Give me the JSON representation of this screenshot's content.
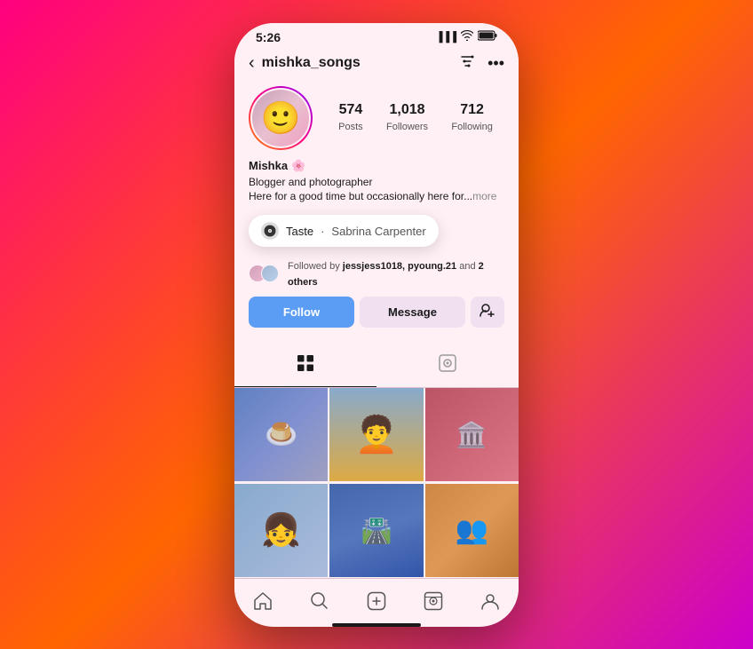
{
  "phone": {
    "status": {
      "time": "5:26",
      "signal": "▪▪▪",
      "wifi": "wifi",
      "battery": "battery"
    },
    "nav": {
      "back_label": "‹",
      "username": "mishka_songs",
      "filter_icon": "filter",
      "more_icon": "more"
    },
    "profile": {
      "name": "Mishka",
      "emoji": "🌸",
      "bio_line1": "Blogger and photographer",
      "bio_line2": "Here for a good time but occasionally here for...",
      "more_label": "more",
      "stats": {
        "posts": {
          "count": "574",
          "label": "Posts"
        },
        "followers": {
          "count": "1,018",
          "label": "Followers"
        },
        "following": {
          "count": "712",
          "label": "Following"
        }
      }
    },
    "tooltip": {
      "icon": "♪",
      "label": "Taste",
      "separator": "·",
      "artist": "Sabrina Carpenter"
    },
    "followed_by": {
      "text": "Followed by ",
      "users": "jessjess1018, pyoung.21",
      "and_label": " and ",
      "others": "2 others"
    },
    "buttons": {
      "follow": "Follow",
      "message": "Message",
      "add_icon": "👤+"
    },
    "tabs": {
      "grid_icon": "⊞",
      "tagged_icon": "◉"
    },
    "grid": {
      "cells": [
        {
          "id": 1,
          "class": "cell-1",
          "content": "food"
        },
        {
          "id": 2,
          "class": "cell-2",
          "content": "person"
        },
        {
          "id": 3,
          "class": "cell-3",
          "content": "temple"
        },
        {
          "id": 4,
          "class": "cell-4",
          "content": "girl"
        },
        {
          "id": 5,
          "class": "cell-5",
          "content": "road"
        },
        {
          "id": 6,
          "class": "cell-6",
          "content": "group"
        }
      ]
    },
    "bottom_nav": {
      "items": [
        {
          "id": "home",
          "icon": "⌂",
          "label": "Home"
        },
        {
          "id": "search",
          "icon": "🔍",
          "label": "Search"
        },
        {
          "id": "add",
          "icon": "⊕",
          "label": "Add"
        },
        {
          "id": "reels",
          "icon": "▶",
          "label": "Reels"
        },
        {
          "id": "profile",
          "icon": "○",
          "label": "Profile"
        }
      ]
    }
  }
}
